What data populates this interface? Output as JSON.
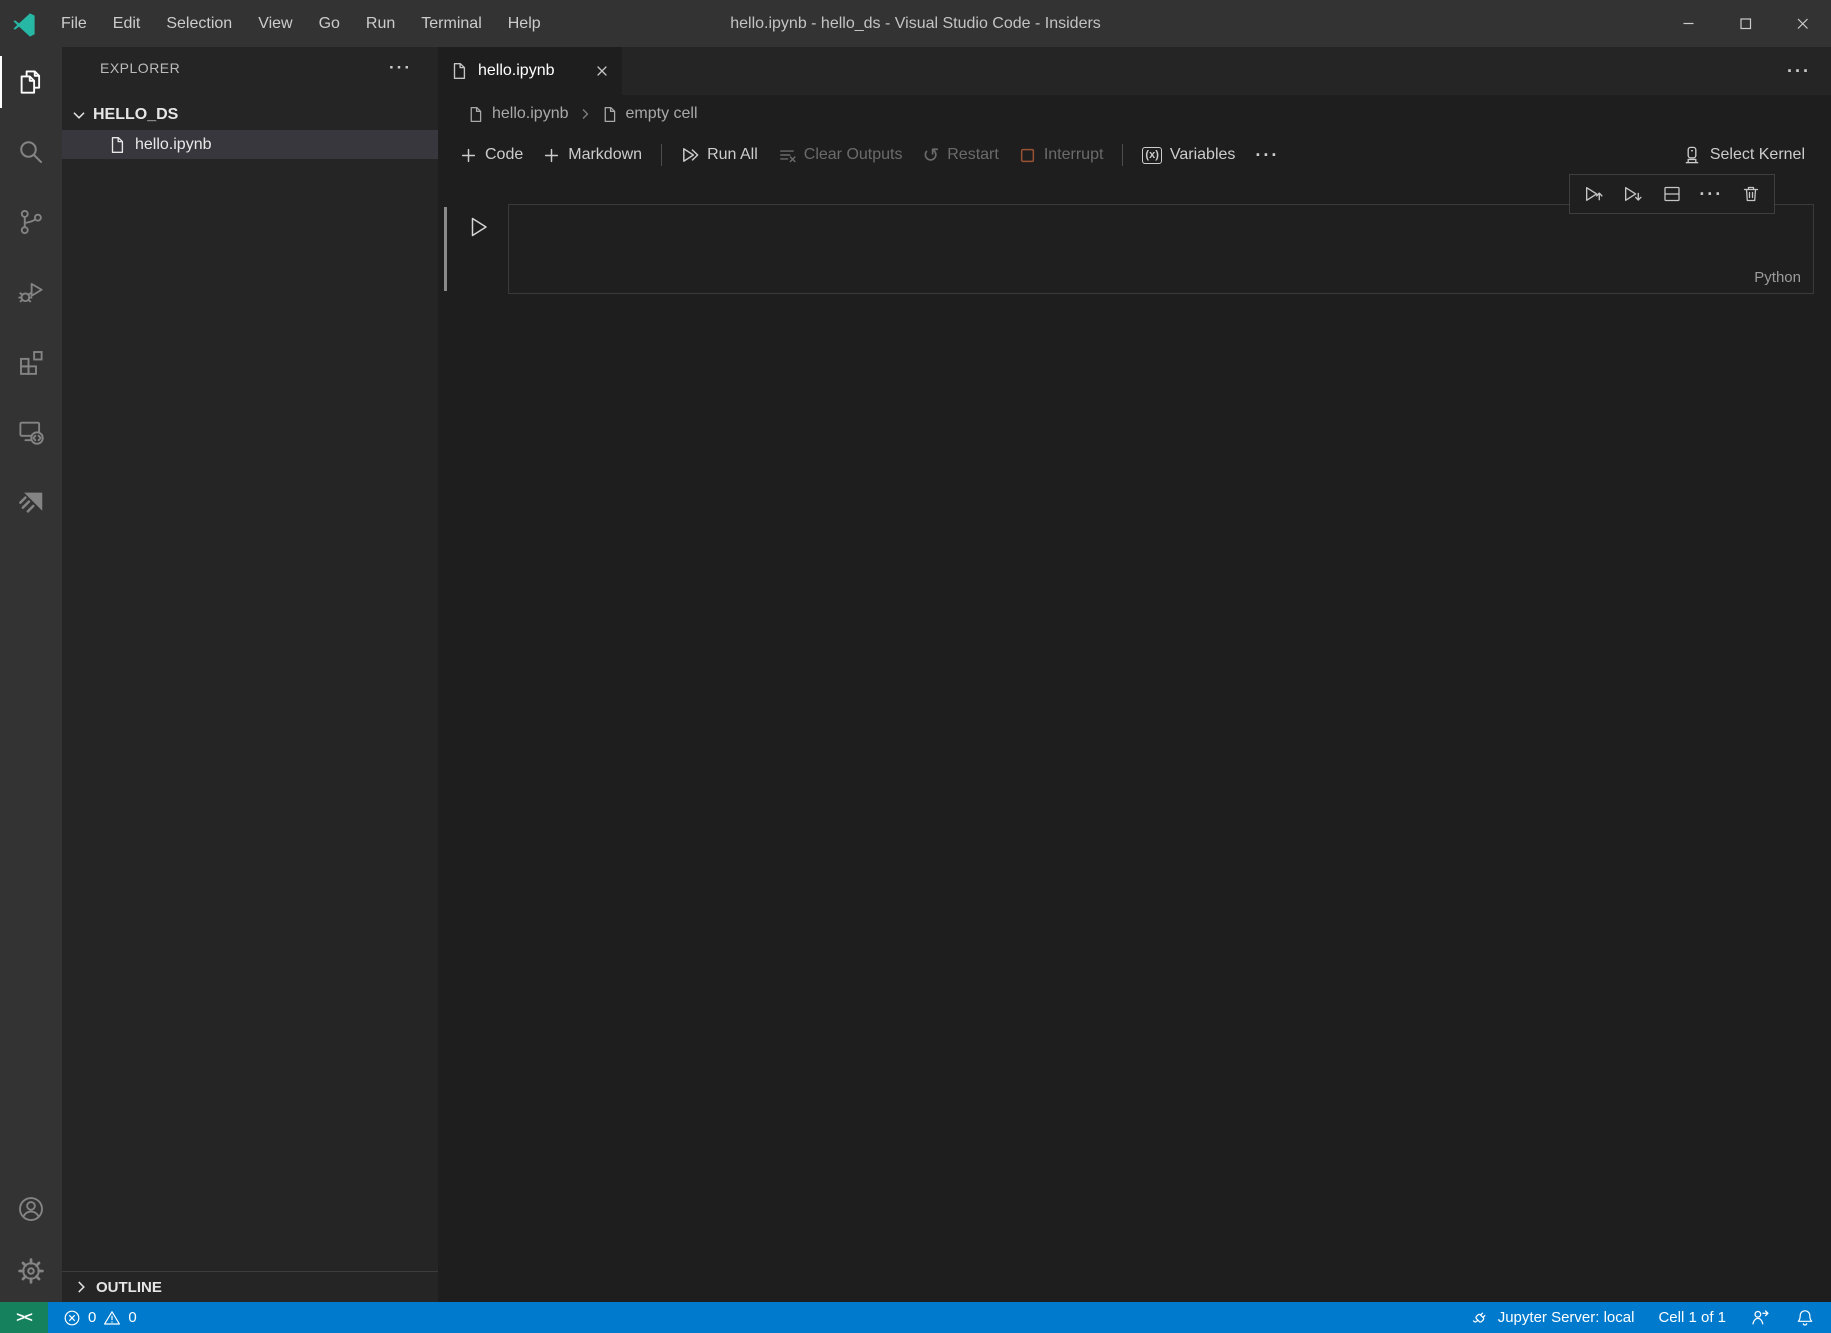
{
  "window": {
    "title": "hello.ipynb - hello_ds - Visual Studio Code - Insiders",
    "menus": [
      "File",
      "Edit",
      "Selection",
      "View",
      "Go",
      "Run",
      "Terminal",
      "Help"
    ]
  },
  "sidebar": {
    "title": "EXPLORER",
    "folder": "HELLO_DS",
    "file": "hello.ipynb",
    "outline": "OUTLINE"
  },
  "editor": {
    "tab_label": "hello.ipynb",
    "breadcrumbs": {
      "file": "hello.ipynb",
      "cell": "empty cell"
    },
    "toolbar": {
      "code": "Code",
      "markdown": "Markdown",
      "run_all": "Run All",
      "clear_outputs": "Clear Outputs",
      "restart": "Restart",
      "interrupt": "Interrupt",
      "variables": "Variables",
      "select_kernel": "Select Kernel"
    },
    "cell_language": "Python"
  },
  "status_bar": {
    "errors": "0",
    "warnings": "0",
    "jupyter": "Jupyter Server: local",
    "cell": "Cell 1 of 1"
  },
  "icons": {
    "ellipsis": "···",
    "restart": "↺",
    "variables": "(x)",
    "remote": "><"
  },
  "colors": {
    "title_bar": "#333333",
    "activity_bar": "#333333",
    "sidebar": "#252526",
    "editor": "#1e1e1e",
    "selected_row": "#37373d",
    "status_bar": "#007acc",
    "remote_indicator": "#16825d",
    "logo_teal": "#26b8a5",
    "interrupt_icon": "#9a5135"
  }
}
